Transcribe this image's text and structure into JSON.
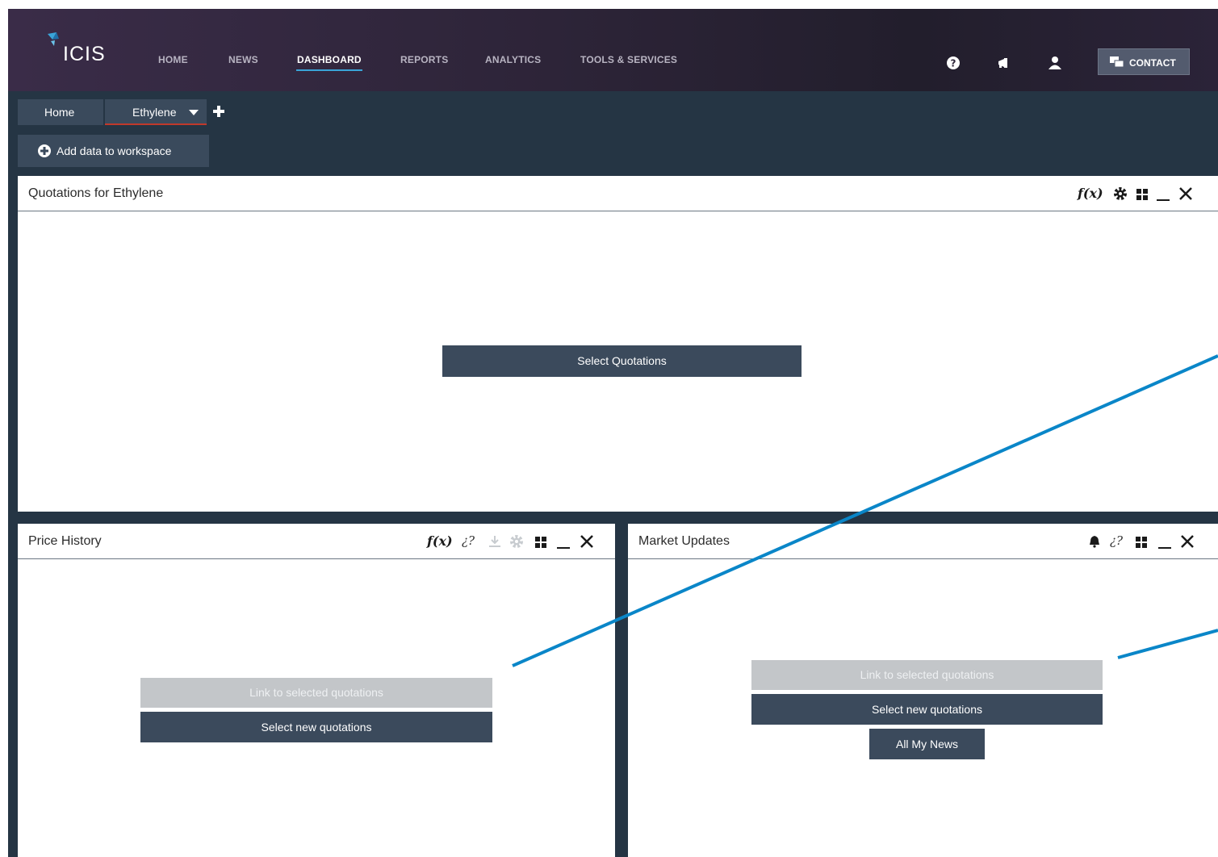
{
  "brand": {
    "logo_text": "ICIS"
  },
  "nav": {
    "items": [
      {
        "label": "HOME"
      },
      {
        "label": "NEWS"
      },
      {
        "label": "DASHBOARD",
        "active": true
      },
      {
        "label": "REPORTS"
      },
      {
        "label": "ANALYTICS"
      },
      {
        "label": "TOOLS & SERVICES"
      }
    ],
    "icons": [
      "help-icon",
      "megaphone-icon",
      "user-icon"
    ],
    "contact_label": "CONTACT"
  },
  "workspace_tabs": [
    {
      "label": "Home"
    },
    {
      "label": "Ethylene",
      "active": true
    }
  ],
  "add_data_label": "Add data to workspace",
  "panels": {
    "quotations": {
      "title": "Quotations for Ethylene",
      "select_label": "Select Quotations",
      "toolbar_icons": [
        "fx-icon",
        "gear-icon",
        "grid-icon",
        "minimize-icon",
        "close-icon"
      ]
    },
    "price_history": {
      "title": "Price History",
      "link_label": "Link to selected quotations",
      "select_label": "Select new quotations",
      "toolbar_icons": [
        "fx-icon",
        "link-icon",
        "download-icon",
        "gear-icon",
        "grid-icon",
        "minimize-icon",
        "close-icon"
      ]
    },
    "market_updates": {
      "title": "Market Updates",
      "link_label": "Link to selected quotations",
      "select_label": "Select new quotations",
      "news_label": "All My News",
      "toolbar_icons": [
        "bell-icon",
        "link-icon",
        "grid-icon",
        "minimize-icon",
        "close-icon"
      ]
    }
  },
  "colors": {
    "nav_bg": "#2d2438",
    "workspace_bg": "#253544",
    "button_dark": "#3b4a5c",
    "button_disabled": "#c3c6c9",
    "active_underline": "#3aa4d8",
    "tab_underline": "#c0392b",
    "annotation_line": "#0a86c8"
  }
}
